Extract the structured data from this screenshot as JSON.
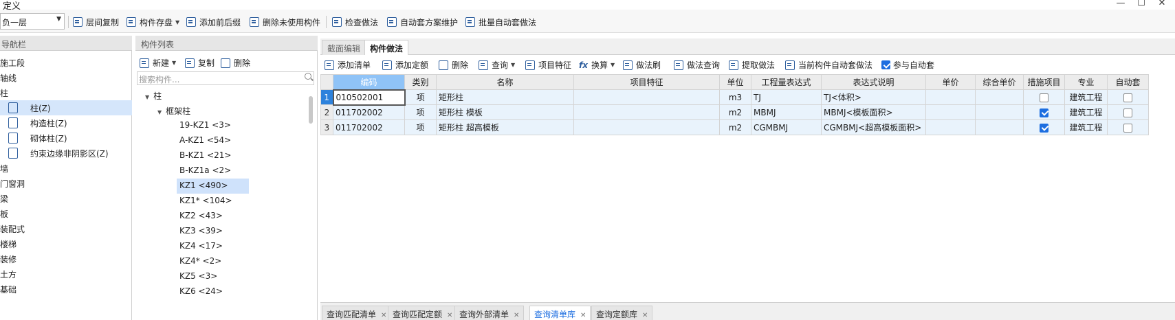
{
  "window": {
    "title": "定义",
    "minimize": "—",
    "maximize": "☐",
    "close": "✕"
  },
  "toolbar": {
    "floor_select": "负一层",
    "buttons": [
      {
        "label": "层间复制",
        "icon": "copy-layers-icon"
      },
      {
        "label": "构件存盘",
        "icon": "save-component-icon",
        "has_dropdown": true
      },
      {
        "label": "添加前后缀",
        "icon": "add-affix-icon"
      },
      {
        "label": "删除未使用构件",
        "icon": "delete-unused-icon"
      },
      {
        "label": "检查做法",
        "icon": "check-method-icon"
      },
      {
        "label": "自动套方案维护",
        "icon": "auto-scheme-icon"
      },
      {
        "label": "批量自动套做法",
        "icon": "batch-auto-icon"
      }
    ]
  },
  "nav": {
    "header": "导航栏",
    "items": [
      {
        "label": "施工段"
      },
      {
        "label": "轴线"
      },
      {
        "label": "柱"
      },
      {
        "label": "柱(Z)",
        "sub": true,
        "selected": true,
        "icon": "column-icon"
      },
      {
        "label": "构造柱(Z)",
        "sub": true,
        "icon": "constructional-column-icon"
      },
      {
        "label": "砌体柱(Z)",
        "sub": true,
        "icon": "masonry-column-icon"
      },
      {
        "label": "约束边缘非阴影区(Z)",
        "sub": true,
        "icon": "constraint-edge-icon"
      },
      {
        "label": "墙"
      },
      {
        "label": "门窗洞"
      },
      {
        "label": "梁"
      },
      {
        "label": "板"
      },
      {
        "label": "装配式"
      },
      {
        "label": "楼梯"
      },
      {
        "label": "装修"
      },
      {
        "label": "土方"
      },
      {
        "label": "基础"
      }
    ]
  },
  "components": {
    "header": "构件列表",
    "tools": {
      "new": "新建",
      "copy": "复制",
      "delete": "删除"
    },
    "search_placeholder": "搜索构件...",
    "tree_root": "柱",
    "tree_group": "框架柱",
    "items": [
      {
        "label": "19-KZ1 <3>"
      },
      {
        "label": "A-KZ1 <54>"
      },
      {
        "label": "B-KZ1 <21>"
      },
      {
        "label": "B-KZ1a <2>"
      },
      {
        "label": "KZ1 <490>",
        "selected": true
      },
      {
        "label": "KZ1* <104>"
      },
      {
        "label": "KZ2 <43>"
      },
      {
        "label": "KZ3 <39>"
      },
      {
        "label": "KZ4 <17>"
      },
      {
        "label": "KZ4* <2>"
      },
      {
        "label": "KZ5 <3>"
      },
      {
        "label": "KZ6 <24>"
      }
    ]
  },
  "main": {
    "tabs": [
      {
        "label": "截面编辑",
        "active": false
      },
      {
        "label": "构件做法",
        "active": true
      }
    ],
    "tools": [
      {
        "label": "添加清单",
        "icon": "add-list-icon"
      },
      {
        "label": "添加定额",
        "icon": "add-quota-icon"
      },
      {
        "label": "删除",
        "icon": "trash-icon"
      },
      {
        "label": "查询",
        "icon": "query-icon",
        "has_dropdown": true
      },
      {
        "label": "项目特征",
        "icon": "feature-icon"
      },
      {
        "label": "换算",
        "icon": "formula-icon",
        "has_dropdown": true
      },
      {
        "label": "做法刷",
        "icon": "brush-icon"
      },
      {
        "label": "做法查询",
        "icon": "method-query-icon"
      },
      {
        "label": "提取做法",
        "icon": "extract-icon"
      },
      {
        "label": "当前构件自动套做法",
        "icon": "auto-apply-icon"
      }
    ],
    "auto_checkbox": {
      "label": "参与自动套",
      "checked": true
    },
    "table": {
      "headers": [
        "",
        "编码",
        "类别",
        "名称",
        "项目特征",
        "单位",
        "工程量表达式",
        "表达式说明",
        "单价",
        "综合单价",
        "措施项目",
        "专业",
        "自动套"
      ],
      "rows": [
        {
          "no": "1",
          "code": "010502001",
          "type": "项",
          "name": "矩形柱",
          "feature": "",
          "unit": "m3",
          "expr": "TJ",
          "expr_desc": "TJ<体积>",
          "price": "",
          "total_price": "",
          "measure": false,
          "major": "建筑工程",
          "auto": false
        },
        {
          "no": "2",
          "code": "011702002",
          "type": "项",
          "name": "矩形柱 模板",
          "feature": "",
          "unit": "m2",
          "expr": "MBMJ",
          "expr_desc": "MBMJ<模板面积>",
          "price": "",
          "total_price": "",
          "measure": true,
          "major": "建筑工程",
          "auto": false
        },
        {
          "no": "3",
          "code": "011702002",
          "type": "项",
          "name": "矩形柱 超高模板",
          "feature": "",
          "unit": "m2",
          "expr": "CGMBMJ",
          "expr_desc": "CGMBMJ<超高模板面积>",
          "price": "",
          "total_price": "",
          "measure": true,
          "major": "建筑工程",
          "auto": false
        }
      ]
    }
  },
  "bottom_tabs": [
    {
      "label": "查询匹配清单",
      "active": false
    },
    {
      "label": "查询匹配定额",
      "active": false
    },
    {
      "label": "查询外部清单",
      "active": false
    },
    {
      "label": "查询清单库",
      "active": true
    },
    {
      "label": "查询定额库",
      "active": false
    }
  ],
  "colors": {
    "accent": "#1d6ee0",
    "selected_row": "#d5e6fb",
    "table_row": "#e9f3fc",
    "header_code": "#8fc3f7"
  }
}
